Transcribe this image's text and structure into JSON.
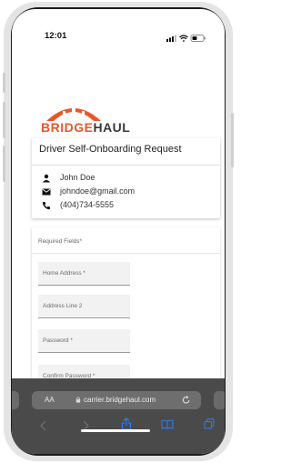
{
  "status_bar": {
    "time": "12:01"
  },
  "logo": {
    "part1": "BRIDGE",
    "part2": "HAUL"
  },
  "card": {
    "title": "Driver Self-Onboarding Request",
    "name": "John Doe",
    "email": "johndoe@gmail.com",
    "phone": "(404)734-5555"
  },
  "form": {
    "required_note": "Required Fields*",
    "fields": [
      {
        "placeholder": "Home Address *"
      },
      {
        "placeholder": "Address Line 2"
      },
      {
        "placeholder": "Password *"
      },
      {
        "placeholder": "Confirm Password *"
      }
    ]
  },
  "browser": {
    "text_size": "AA",
    "url": "carrier.bridgehaul.com"
  },
  "icons": [
    "person-icon",
    "mail-icon",
    "phone-icon",
    "signal-icon",
    "wifi-icon",
    "battery-icon",
    "lock-icon",
    "reload-icon",
    "back-icon",
    "forward-icon",
    "share-icon",
    "bookmarks-icon",
    "tabs-icon"
  ],
  "colors": {
    "brand": "#e8572a",
    "brand_dark": "#3a3a3a"
  }
}
